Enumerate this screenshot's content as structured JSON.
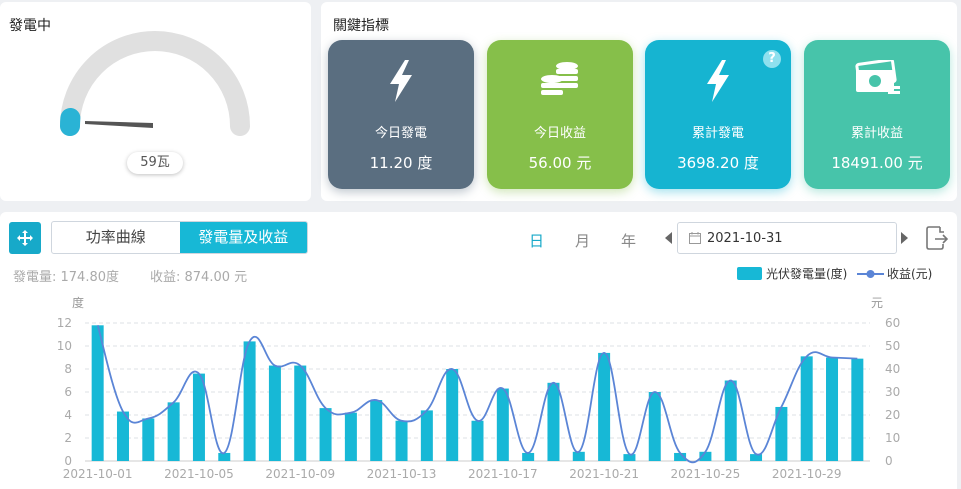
{
  "gauge": {
    "title": "發電中",
    "value_label": "59瓦",
    "level": 0.03,
    "colors": {
      "track": "#e0e0e0",
      "fill": "#2ab3d5",
      "needle": "#555555"
    }
  },
  "kpis": {
    "title": "關鍵指標",
    "items": [
      {
        "label": "今日發電",
        "value": "11.20 度",
        "icon": "lightning-icon",
        "color": "#5a6e80"
      },
      {
        "label": "今日收益",
        "value": "56.00 元",
        "icon": "coin-stack-icon",
        "color": "#86bf4a"
      },
      {
        "label": "累計發電",
        "value": "3698.20 度",
        "icon": "lightning-icon",
        "color": "#16b4d1",
        "help": "?"
      },
      {
        "label": "累計收益",
        "value": "18491.00 元",
        "icon": "money-icon",
        "color": "#47c4aa"
      }
    ]
  },
  "toolbar": {
    "move_icon": "move-icon",
    "tabs": [
      "功率曲線",
      "發電量及收益"
    ],
    "active_tab": 1,
    "periods": [
      "日",
      "月",
      "年"
    ],
    "active_period": 0,
    "date": "2021-10-31",
    "calendar_icon": "calendar-icon",
    "export_icon": "export-icon"
  },
  "summary": {
    "generation": "發電量: 174.80度",
    "revenue": "收益: 874.00 元"
  },
  "chart_data": {
    "type": "bar",
    "x": [
      "2021-10-01",
      "2021-10-02",
      "2021-10-03",
      "2021-10-04",
      "2021-10-05",
      "2021-10-06",
      "2021-10-07",
      "2021-10-08",
      "2021-10-09",
      "2021-10-10",
      "2021-10-11",
      "2021-10-12",
      "2021-10-13",
      "2021-10-14",
      "2021-10-15",
      "2021-10-16",
      "2021-10-17",
      "2021-10-18",
      "2021-10-19",
      "2021-10-20",
      "2021-10-21",
      "2021-10-22",
      "2021-10-23",
      "2021-10-24",
      "2021-10-25",
      "2021-10-26",
      "2021-10-27",
      "2021-10-28",
      "2021-10-29",
      "2021-10-30",
      "2021-10-31"
    ],
    "x_tick_labels": [
      "2021-10-01",
      "2021-10-05",
      "2021-10-09",
      "2021-10-13",
      "2021-10-17",
      "2021-10-21",
      "2021-10-25",
      "2021-10-29"
    ],
    "series": [
      {
        "name": "光伏發電量(度)",
        "type": "bar",
        "axis": "left",
        "color": "#17b8d6",
        "values": [
          11.8,
          4.3,
          3.7,
          5.1,
          7.6,
          0.7,
          10.4,
          8.3,
          8.3,
          4.6,
          4.2,
          5.3,
          3.5,
          4.4,
          8.0,
          3.5,
          6.3,
          0.7,
          6.8,
          0.8,
          9.4,
          0.6,
          6.0,
          0.7,
          0.8,
          7.0,
          0.6,
          4.7,
          9.1,
          9.0,
          8.9
        ]
      },
      {
        "name": "收益(元)",
        "type": "line",
        "axis": "right",
        "color": "#5b85d6",
        "values": [
          59,
          21.5,
          18.5,
          25.5,
          38,
          3.5,
          52,
          41.5,
          41.5,
          23,
          21,
          26.5,
          17.5,
          22,
          40,
          17.5,
          31.5,
          3.5,
          34,
          4,
          47,
          3,
          30,
          3.5,
          4,
          35,
          3,
          23.5,
          45.5,
          45,
          44.5
        ]
      }
    ],
    "y_left": {
      "unit": "度",
      "ylim": [
        0,
        12
      ],
      "ticks": [
        "0",
        "2",
        "4",
        "6",
        "8",
        "10",
        "12"
      ]
    },
    "y_right": {
      "unit": "元",
      "ylim": [
        0,
        60
      ],
      "ticks": [
        "0",
        "10",
        "20",
        "30",
        "40",
        "50",
        "60"
      ]
    },
    "grid": true,
    "legend_position": "top-right"
  }
}
